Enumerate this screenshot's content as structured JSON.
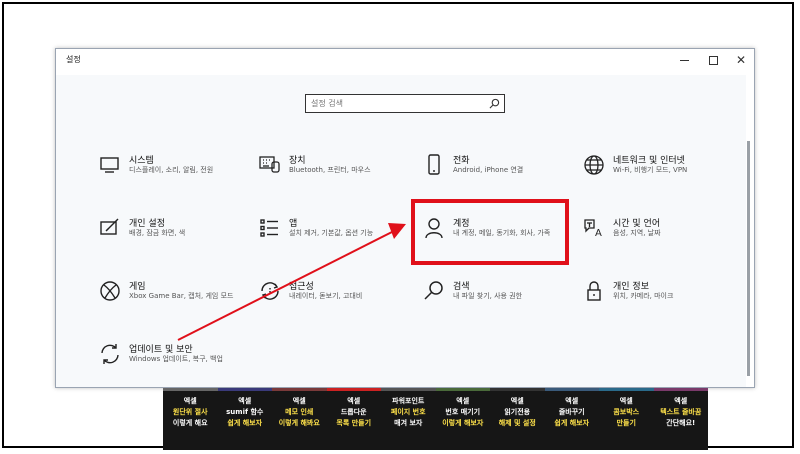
{
  "window": {
    "title": "설정",
    "controls": {
      "minimize": "—",
      "maximize": "",
      "close": "✕"
    }
  },
  "search": {
    "placeholder": "설정 검색"
  },
  "tiles": [
    {
      "title": "시스템",
      "desc": "디스플레이, 소리, 알림, 전원",
      "icon": "monitor-icon"
    },
    {
      "title": "장치",
      "desc": "Bluetooth, 프린터, 마우스",
      "icon": "keyboard-icon"
    },
    {
      "title": "전화",
      "desc": "Android, iPhone 연결",
      "icon": "phone-icon"
    },
    {
      "title": "네트워크 및 인터넷",
      "desc": "Wi-Fi, 비행기 모드, VPN",
      "icon": "globe-icon"
    },
    {
      "title": "개인 설정",
      "desc": "배경, 잠금 화면, 색",
      "icon": "pen-tablet-icon"
    },
    {
      "title": "앱",
      "desc": "설치 제거, 기본값, 옵션 기능",
      "icon": "apps-list-icon"
    },
    {
      "title": "계정",
      "desc": "내 계정, 메일, 동기화, 회사, 가족",
      "icon": "person-icon"
    },
    {
      "title": "시간 및 언어",
      "desc": "음성, 지역, 날짜",
      "icon": "time-language-icon"
    },
    {
      "title": "게임",
      "desc": "Xbox Game Bar, 캡처, 게임 모드",
      "icon": "xbox-icon"
    },
    {
      "title": "접근성",
      "desc": "내레이터, 돋보기, 고대비",
      "icon": "accessibility-icon"
    },
    {
      "title": "검색",
      "desc": "내 파일 찾기, 사용 권한",
      "icon": "magnifier-icon"
    },
    {
      "title": "개인 정보",
      "desc": "위치, 카메라, 마이크",
      "icon": "lock-icon"
    },
    {
      "title": "업데이트 및 보안",
      "desc": "Windows 업데이트, 복구, 백업",
      "icon": "sync-icon"
    }
  ],
  "banners": [
    {
      "line1": "엑셀",
      "line2": "원단위 절사",
      "line3": "이렇게 해요"
    },
    {
      "line1": "엑셀",
      "line2": "sumif 함수",
      "line3": "쉽게 해보자"
    },
    {
      "line1": "엑셀",
      "line2": "메모 인쇄",
      "line3": "이렇게 해봐요"
    },
    {
      "line1": "엑셀",
      "line2": "드롭다운",
      "line3": "목록 만들기"
    },
    {
      "line1": "파워포인트",
      "line2": "페이지 번호",
      "line3": "매겨 보자"
    },
    {
      "line1": "엑셀",
      "line2": "번호 매기기",
      "line3": "이렇게 해보자"
    },
    {
      "line1": "엑셀",
      "line2": "읽기전용",
      "line3": "해제 및 설정"
    },
    {
      "line1": "엑셀",
      "line2": "줄바꾸기",
      "line3": "쉽게 해보자"
    },
    {
      "line1": "엑셀",
      "line2": "콤보박스",
      "line3": "만들기"
    },
    {
      "line1": "엑셀",
      "line2": "텍스트 줄바꿈",
      "line3": "간단해요!"
    }
  ],
  "colors": {
    "highlight": "#e0101a",
    "banner_accent": "#ffe24a"
  }
}
